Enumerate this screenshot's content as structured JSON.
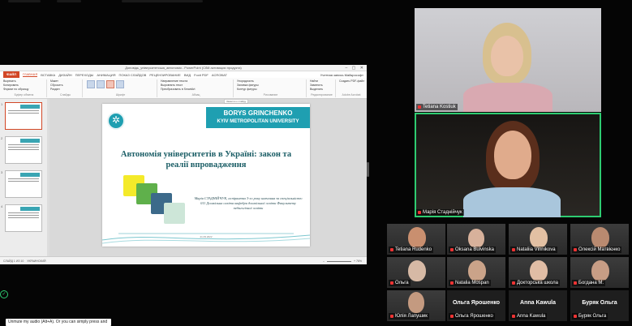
{
  "powerpoint": {
    "window_title": "Доповідь_університетська_автономія - PowerPoint (Сбій активации продукта)",
    "tabs": [
      "ФАЙЛ",
      "ГЛАВНАЯ",
      "ВСТАВКА",
      "ДИЗАЙН",
      "ПЕРЕХОДЫ",
      "АНИМАЦИЯ",
      "ПОКАЗ СЛАЙДОВ",
      "РЕЦЕНЗИРОВАНИЕ",
      "ВИД",
      "Foxit PDF",
      "ACROBAT"
    ],
    "account": "Учетная запись Майкрософт",
    "ribbon_groups": [
      "Буфер обмена",
      "Слайды",
      "Шрифт",
      "Абзац",
      "Рисование",
      "Редактирование",
      "Adobe Acrobat"
    ],
    "ribbon_buttons": {
      "paste": "Вставить",
      "cut": "Вырезать",
      "copy": "Копировать",
      "format_painter": "Формат по образцу",
      "new_slide": "Создать слайд",
      "layout": "Макет",
      "reset": "Сбросить",
      "section": "Раздел",
      "text_direction": "Направление текста",
      "align_text": "Выровнять текст",
      "smartart": "Преобразовать в SmartArt",
      "arrange": "Упорядочить",
      "quick_styles": "Экспресс-стили",
      "shape_fill": "Заливка фигуры",
      "shape_outline": "Контур фигуры",
      "shape_effects": "Эффекты фигуры",
      "find": "Найти",
      "replace": "Заменить",
      "select": "Выделить",
      "create_pdf": "Создать PDF-файл"
    },
    "slide": {
      "banner_line1": "BORYS GRINCHENKO",
      "banner_line2": "KYIV METROPOLITAN UNIVERSITY",
      "title": "Автономія університетів в Україні: закон та реалії впровадження",
      "author": "Марія СТАДНІЙЧУК, аспірантка 3-го року навчання за спеціальністю 011 Дошкільна освіта кафедри дошкільної освіти Факультету педагогічної освіти",
      "date": "21.09.2022",
      "notes_hint": "Заметки к слайду"
    },
    "status": {
      "slide_of": "СЛАЙД 1 ИЗ 10",
      "language": "УКРАИНСКИЙ",
      "zoom": "76%"
    }
  },
  "speakers": [
    {
      "name": "Tetiana Kostiuk"
    },
    {
      "name": "Марія Стаднійчук"
    }
  ],
  "participants": [
    {
      "name": "Tetiana Rudenko"
    },
    {
      "name": "Oksana Bulvinska"
    },
    {
      "name": "Nataliia Vinnikova"
    },
    {
      "name": "Олексій Матвієнко"
    },
    {
      "name": "Ольга"
    },
    {
      "name": "Natalia Mospan"
    },
    {
      "name": "Докторська школа"
    },
    {
      "name": "Богдана М."
    },
    {
      "name": "Юлія Лапушик"
    },
    {
      "name": "Ольга Ярошенко",
      "center": "Ольга Ярошенко"
    },
    {
      "name": "Anna Kawula",
      "center": "Anna Kawula"
    },
    {
      "name": "Буряк Ольга",
      "center": "Буряк Ольга"
    }
  ],
  "toast": "Unmute my audio (Alt+A). Or you can simply press and",
  "colors": {
    "speaking": "#2ecc71",
    "ppt_accent": "#d24726",
    "slide_banner": "#1f9fb1"
  }
}
